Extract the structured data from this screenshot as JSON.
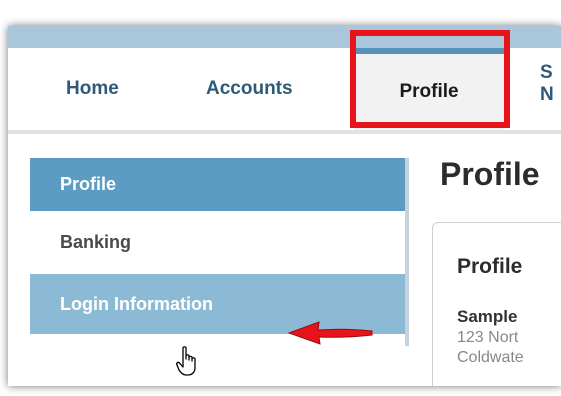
{
  "nav": {
    "home": "Home",
    "accounts": "Accounts",
    "profile": "Profile",
    "partial_line1": "S",
    "partial_line2": "N"
  },
  "sidebar": {
    "items": [
      {
        "label": "Profile"
      },
      {
        "label": "Banking"
      },
      {
        "label": "Login Information"
      }
    ]
  },
  "main": {
    "title": "Profile",
    "panel": {
      "title": "Profile",
      "name": "Sample",
      "address_line1": "123 Nort",
      "address_line2": "Coldwate"
    }
  },
  "colors": {
    "accent": "#5c9cc2",
    "highlight": "#e8141b",
    "nav_text": "#2f5a78"
  },
  "icons": [
    "pointer-hand-icon",
    "red-arrow-icon"
  ]
}
